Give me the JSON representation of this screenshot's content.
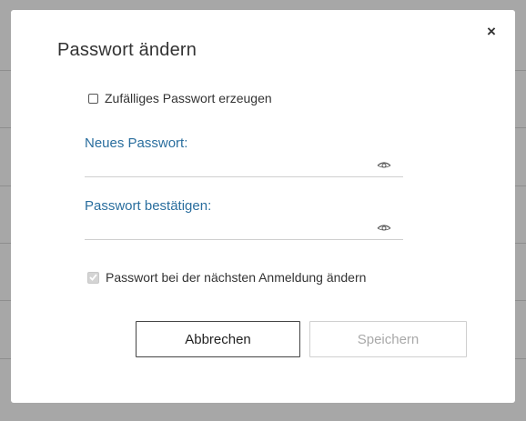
{
  "dialog": {
    "title": "Passwort ändern",
    "close_symbol": "×"
  },
  "random_password": {
    "label": "Zufälliges Passwort erzeugen",
    "checked": false
  },
  "new_password": {
    "label": "Neues Passwort:",
    "value": "",
    "icon": "eye-icon"
  },
  "confirm_password": {
    "label": "Passwort bestätigen:",
    "value": "",
    "icon": "eye-icon"
  },
  "change_next_login": {
    "label": "Passwort bei der nächsten Anmeldung ändern",
    "checked": true,
    "disabled": true
  },
  "buttons": {
    "cancel": "Abbrechen",
    "save": "Speichern"
  },
  "colors": {
    "label_accent": "#2a6e9e",
    "disabled_text": "#a9a9a9"
  }
}
